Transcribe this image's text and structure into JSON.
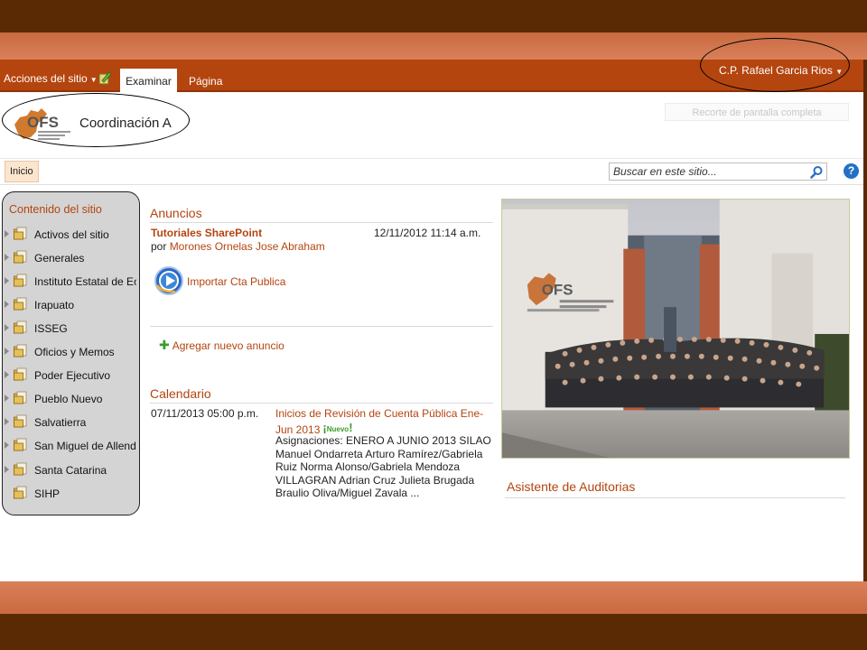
{
  "ribbon": {
    "site_actions": "Acciones del sitio",
    "tab_browse": "Examinar",
    "tab_page": "Página",
    "user_name": "C.P. Rafael Garcia Rios"
  },
  "header": {
    "site_title": "Coordinación A",
    "fullscreen_label": "Recorte de pantalla completa",
    "logo_text": "OFS"
  },
  "nav": {
    "home": "Inicio",
    "search_placeholder": "Buscar en este sitio..."
  },
  "sidebar": {
    "title": "Contenido del sitio",
    "items": [
      {
        "label": "Activos del sitio"
      },
      {
        "label": "Generales"
      },
      {
        "label": "Instituto Estatal de Ec"
      },
      {
        "label": "Irapuato"
      },
      {
        "label": "ISSEG"
      },
      {
        "label": "Oficios y Memos"
      },
      {
        "label": "Poder Ejecutivo"
      },
      {
        "label": "Pueblo Nuevo"
      },
      {
        "label": "Salvatierra"
      },
      {
        "label": "San Miguel de Allende"
      },
      {
        "label": "Santa Catarina"
      },
      {
        "label": "SIHP"
      }
    ]
  },
  "announcements": {
    "title": "Anuncios",
    "item_title": "Tutoriales SharePoint",
    "item_date": "12/11/2012 11:14 a.m.",
    "by_prefix": "por",
    "author": "Morones Ornelas Jose Abraham",
    "media_label": "Importar Cta Publica",
    "add_label": "Agregar nuevo anuncio"
  },
  "calendar": {
    "title": "Calendario",
    "event_date": "07/11/2013 05:00 p.m.",
    "event_title": "Inicios de Revisión de Cuenta Pública Ene-Jun 2013",
    "new_badge": "Nuevo",
    "event_desc": "Asignaciones: ENERO A JUNIO 2013 SILAO Manuel Ondarreta Arturo Ramírez/Gabriela Ruiz Norma Alonso/Gabriela Mendoza VILLAGRAN Adrian Cruz Julieta Brugada Braulio Oliva/Miguel Zavala ..."
  },
  "right": {
    "auditor_title": "Asistente de Auditorias"
  },
  "colors": {
    "ribbon": "#b4450f",
    "accent": "#b4450f",
    "frame_dark": "#5a2a05",
    "frame_light": "#d9805a"
  }
}
